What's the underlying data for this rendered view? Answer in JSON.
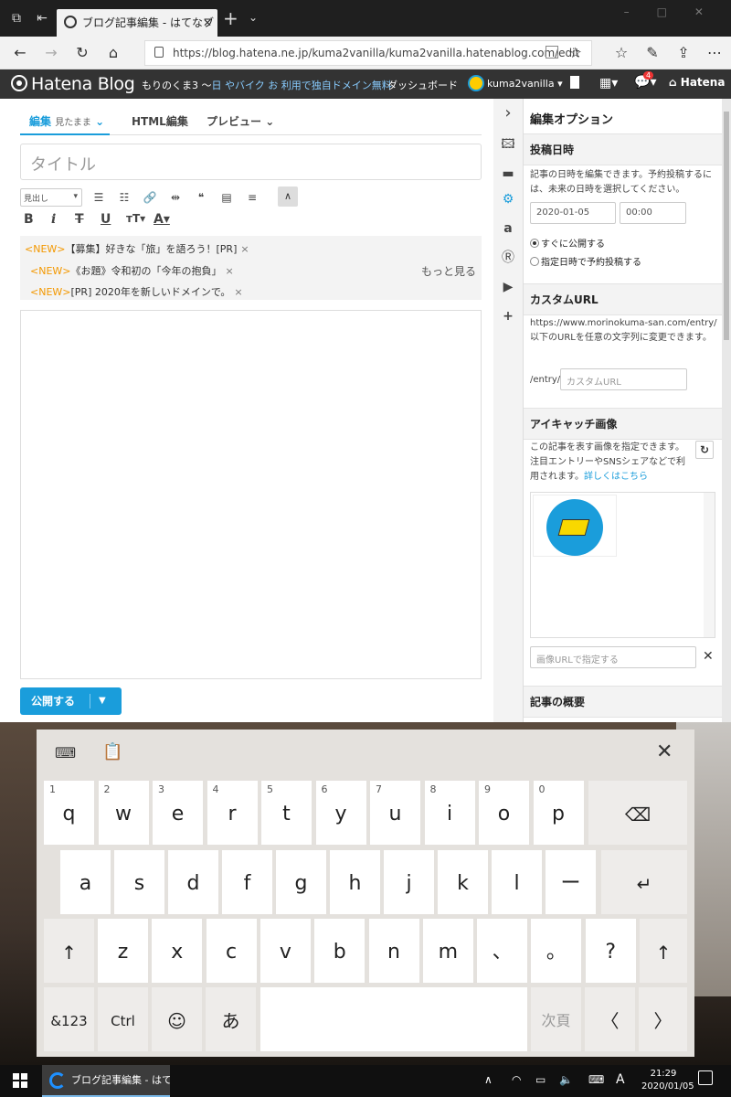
{
  "browser": {
    "tab_title": "ブログ記事編集 - はてなブ",
    "url": "https://blog.hatena.ne.jp/kuma2vanilla/kuma2vanilla.hatenablog.com/edit"
  },
  "hatena_bar": {
    "logo": "Hatena Blog",
    "blog_name": "もりのくま3 〜",
    "blog_name_overlay": "日 やバイク お 利用で独自ドメイン無料",
    "dashboard": "ダッシュボード",
    "user": "kuma2vanilla",
    "notif_count": "4",
    "brand": "Hatena"
  },
  "editor": {
    "tabs": [
      {
        "label": "編集",
        "sub": "見たまま"
      },
      {
        "label": "HTML編集"
      },
      {
        "label": "プレビュー"
      }
    ],
    "title_placeholder": "タイトル",
    "heading_select": "見出し",
    "news": [
      {
        "tag": "<NEW>",
        "text": "【募集】好きな「旅」を語ろう！[PR]"
      },
      {
        "tag": "<NEW>",
        "text": "《お題》令和初の「今年の抱負」"
      },
      {
        "tag": "<NEW>",
        "text": "[PR] 2020年を新しいドメインで。"
      }
    ],
    "more_link": "もっと見る",
    "publish_button": "公開する"
  },
  "side_panel": {
    "title": "編集オプション",
    "post_date": {
      "heading": "投稿日時",
      "desc": "記事の日時を編集できます。予約投稿するには、未来の日時を選択してください。",
      "date": "2020-01-05",
      "time": "00:00",
      "radio_now": "すぐに公開する",
      "radio_schedule": "指定日時で予約投稿する"
    },
    "custom_url": {
      "heading": "カスタムURL",
      "desc": "https://www.morinokuma-san.com/entry/以下のURLを任意の文字列に変更できます。",
      "prefix": "/entry/",
      "placeholder": "カスタムURL"
    },
    "eyecatch": {
      "heading": "アイキャッチ画像",
      "desc": "この記事を表す画像を指定できます。注目エントリーやSNSシェアなどで利用されます。",
      "link": "詳しくはこちら",
      "url_placeholder": "画像URLで指定する"
    },
    "summary": {
      "heading": "記事の概要"
    }
  },
  "keyboard": {
    "row1": [
      {
        "num": "1",
        "key": "q"
      },
      {
        "num": "2",
        "key": "w"
      },
      {
        "num": "3",
        "key": "e"
      },
      {
        "num": "4",
        "key": "r"
      },
      {
        "num": "5",
        "key": "t"
      },
      {
        "num": "6",
        "key": "y"
      },
      {
        "num": "7",
        "key": "u"
      },
      {
        "num": "8",
        "key": "i"
      },
      {
        "num": "9",
        "key": "o"
      },
      {
        "num": "0",
        "key": "p"
      }
    ],
    "row2": [
      "a",
      "s",
      "d",
      "f",
      "g",
      "h",
      "j",
      "k",
      "l",
      "ー"
    ],
    "row3": [
      "z",
      "x",
      "c",
      "v",
      "b",
      "n",
      "m",
      "、",
      "。",
      "?"
    ],
    "backspace": "⌫",
    "enter": "↵",
    "shift": "↑",
    "sym": "&123",
    "ctrl": "Ctrl",
    "emoji": "☺",
    "kana": "あ",
    "next": "次頁",
    "left": "〈",
    "right": "〉"
  },
  "taskbar": {
    "app_title": "ブログ記事編集 - はて...",
    "ime": "A",
    "time": "21:29",
    "date": "2020/01/05"
  }
}
